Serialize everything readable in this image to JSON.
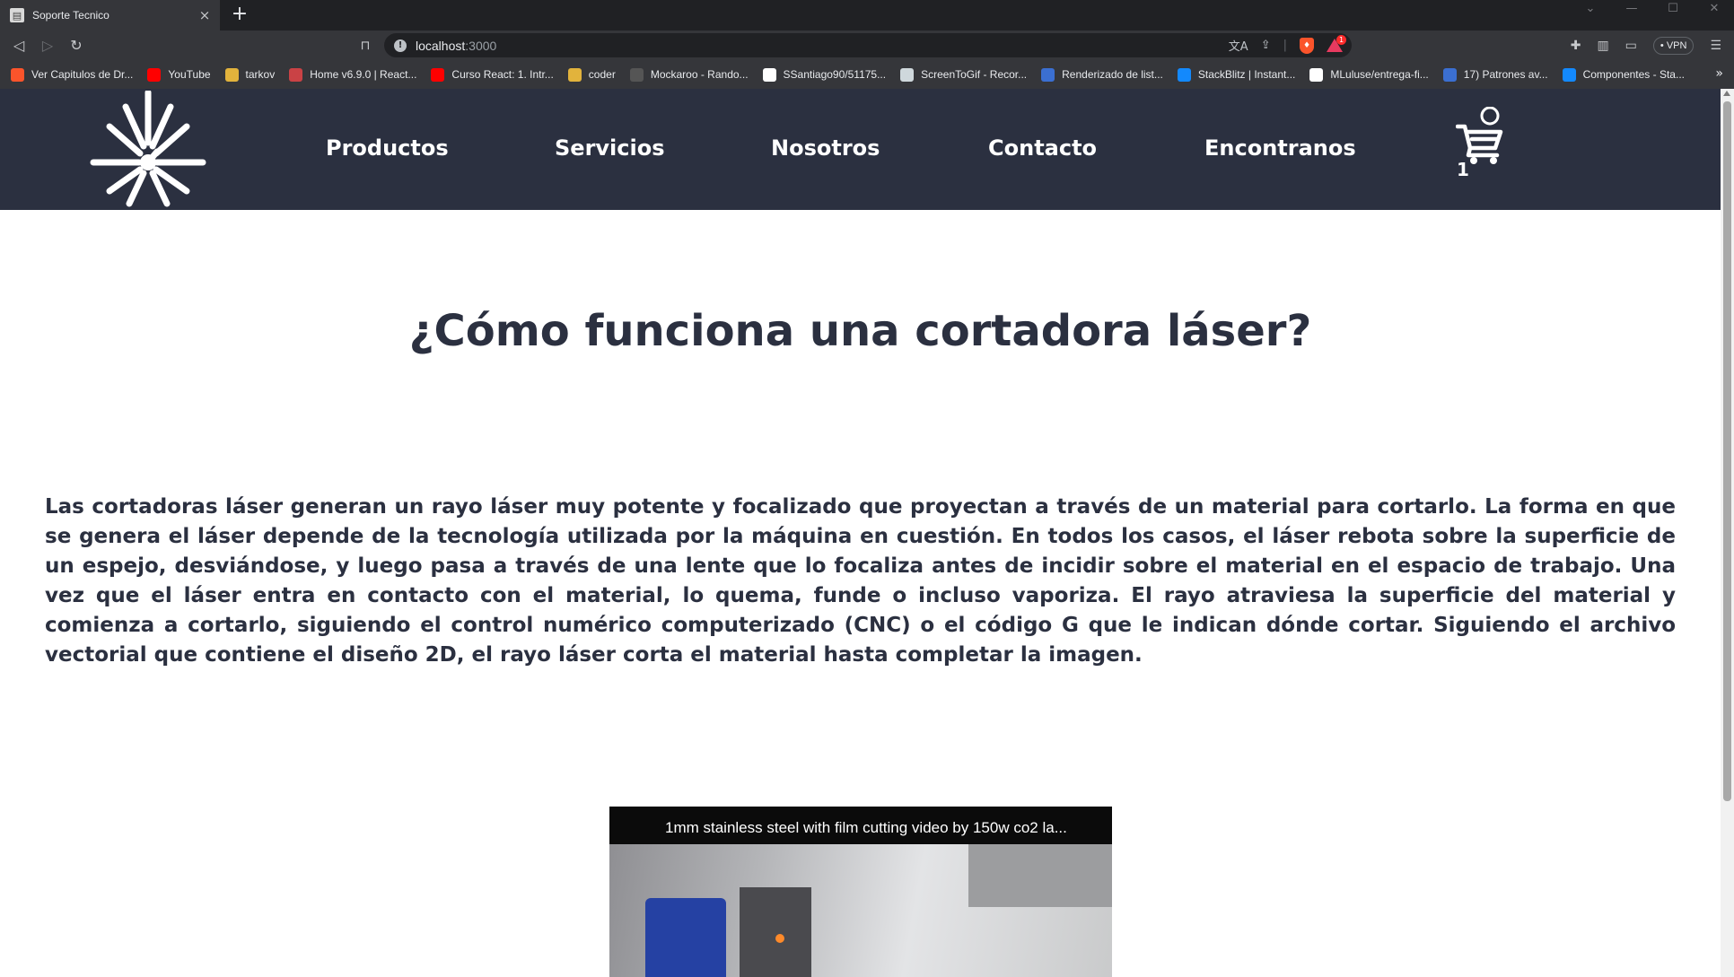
{
  "browser": {
    "tab_title": "Soporte Tecnico",
    "tab_close": "×",
    "new_tab": "+",
    "url_host": "localhost",
    "url_port": ":3000",
    "vpn_label": "• VPN",
    "rewards_badge": "1",
    "bookmarks": [
      {
        "label": "Ver Capitulos de Dr...",
        "icon": "brave-icon",
        "color": "#fb542b"
      },
      {
        "label": "YouTube",
        "icon": "youtube-icon",
        "color": "#ff0000"
      },
      {
        "label": "tarkov",
        "icon": "folder-icon",
        "color": "#e2b33c"
      },
      {
        "label": "Home v6.9.0 | React...",
        "icon": "react-router-icon",
        "color": "#ca4245"
      },
      {
        "label": "Curso React: 1. Intr...",
        "icon": "youtube-icon",
        "color": "#ff0000"
      },
      {
        "label": "coder",
        "icon": "folder-icon",
        "color": "#e2b33c"
      },
      {
        "label": "Mockaroo - Rando...",
        "icon": "mockaroo-icon",
        "color": "#555555"
      },
      {
        "label": "SSantiago90/51175...",
        "icon": "github-icon",
        "color": "#ffffff"
      },
      {
        "label": "ScreenToGif - Recor...",
        "icon": "screentogif-icon",
        "color": "#cfd8dc"
      },
      {
        "label": "Renderizado de list...",
        "icon": "react-icon",
        "color": "#3b6fd1"
      },
      {
        "label": "StackBlitz | Instant...",
        "icon": "stackblitz-icon",
        "color": "#1389fd"
      },
      {
        "label": "MLuluse/entrega-fi...",
        "icon": "github-icon",
        "color": "#ffffff"
      },
      {
        "label": "17) Patrones av...",
        "icon": "react-icon",
        "color": "#3b6fd1"
      },
      {
        "label": "Componentes - Sta...",
        "icon": "stackblitz-icon",
        "color": "#1389fd"
      }
    ],
    "bookmarks_more": "»"
  },
  "site": {
    "nav": {
      "productos": "Productos",
      "servicios": "Servicios",
      "nosotros": "Nosotros",
      "contacto": "Contacto",
      "encontranos": "Encontranos"
    },
    "cart_count": "1",
    "header_bg": "#2b3040"
  },
  "main": {
    "title": "¿Cómo funciona una cortadora láser?",
    "paragraph": "Las cortadoras láser generan un rayo láser muy potente y focalizado que proyectan a través de un material para cortarlo. La forma en que se genera el láser depende de la tecnología utilizada por la máquina en cuestión. En todos los casos, el láser rebota sobre la superficie de un espejo, desviándose, y luego pasa a través de una lente que lo focaliza antes de incidir sobre el material en el espacio de trabajo. Una vez que el láser entra en contacto con el material, lo quema, funde o incluso vaporiza. El rayo atraviesa la superficie del material y comienza a cortarlo, siguiendo el control numérico computerizado (CNC) o el código G que le indican dónde cortar. Siguiendo el archivo vectorial que contiene el diseño 2D, el rayo láser corta el material hasta completar la imagen.",
    "video_title": "1mm stainless steel with film cutting video by 150w co2 la..."
  }
}
